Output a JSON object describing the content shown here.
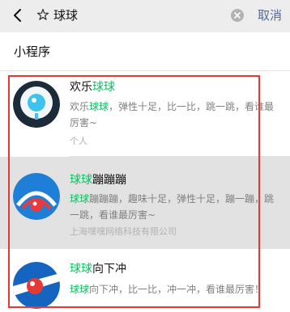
{
  "search": {
    "query": "球球",
    "cancel_label": "取消"
  },
  "section": {
    "title": "小程序"
  },
  "results": [
    {
      "title_pre": "欢乐",
      "title_hl": "球球",
      "title_post": "",
      "desc_pre": "欢乐",
      "desc_hl": "球球",
      "desc_post": "，弹性十足，比一比，跳一跳，看谁最厉害~",
      "meta": "个人"
    },
    {
      "title_pre": "",
      "title_hl": "球球",
      "title_post": "蹦蹦蹦",
      "desc_pre": "",
      "desc_hl": "球球",
      "desc_post": "蹦蹦蹦，趣味十足，弹性十足，蹦一蹦，跳一跳，看谁最厉害~",
      "meta": "上海嘿嘿网络科技有限公司"
    },
    {
      "title_pre": "",
      "title_hl": "球球",
      "title_post": "向下冲",
      "desc_pre": "",
      "desc_hl": "球球",
      "desc_post": "向下冲，比一比，冲一冲，看谁最厉害！",
      "meta": ""
    }
  ],
  "colors": {
    "highlight_text": "#07c160",
    "cancel_link": "#576b95",
    "annotation_frame": "#e53935",
    "page_background": "#ededed"
  },
  "icons": {
    "back": "chevron-left-icon",
    "search_prefix": "sparkle-icon",
    "clear": "clear-icon"
  }
}
